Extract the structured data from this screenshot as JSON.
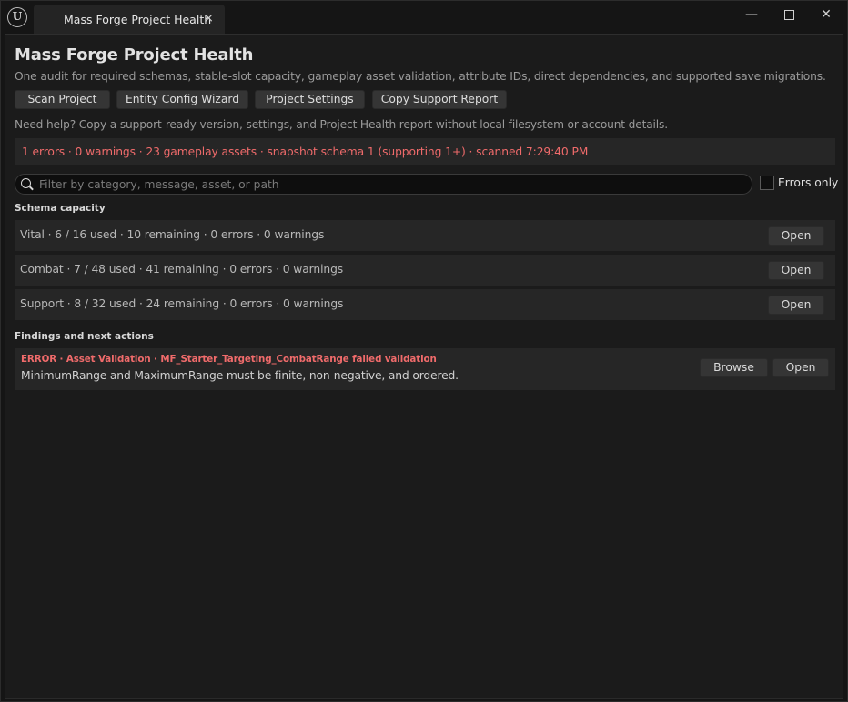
{
  "titlebar": {
    "logo_glyph": "U",
    "tab_label": "Mass Forge Project Health",
    "tab_close": "×",
    "minimize": "—",
    "close": "✕"
  },
  "header": {
    "title": "Mass Forge Project Health",
    "subtitle": "One audit for required schemas, stable-slot capacity, gameplay asset validation, attribute IDs, direct dependencies, and supported save migrations."
  },
  "toolbar": {
    "scan_label": "Scan Project",
    "wizard_label": "Entity Config Wizard",
    "settings_label": "Project Settings",
    "copy_label": "Copy Support Report"
  },
  "help_text": "Need help? Copy a support-ready version, settings, and Project Health report without local filesystem or account details.",
  "summary": {
    "text": "1 errors · 0 warnings · 23 gameplay assets · snapshot schema 1 (supporting 1+) · scanned 7:29:40 PM"
  },
  "filter": {
    "placeholder": "Filter by category, message, asset, or path",
    "errors_only_label": "Errors only",
    "errors_only_checked": false
  },
  "schema_capacity": {
    "heading": "Schema capacity",
    "rows": [
      {
        "text": "Vital · 6 / 16 used · 10 remaining · 0 errors · 0 warnings",
        "open_label": "Open"
      },
      {
        "text": "Combat · 7 / 48 used · 41 remaining · 0 errors · 0 warnings",
        "open_label": "Open"
      },
      {
        "text": "Support · 8 / 32 used · 24 remaining · 0 errors · 0 warnings",
        "open_label": "Open"
      }
    ]
  },
  "findings": {
    "heading": "Findings and next actions",
    "items": [
      {
        "title": "ERROR · Asset Validation · MF_Starter_Targeting_CombatRange failed validation",
        "message": "MinimumRange and MaximumRange must be finite, non-negative, and ordered.",
        "browse_label": "Browse",
        "open_label": "Open"
      }
    ]
  },
  "colors": {
    "error": "#f06b6b",
    "background": "#1b1b1b",
    "row_background": "#262626",
    "button": "#353535"
  }
}
